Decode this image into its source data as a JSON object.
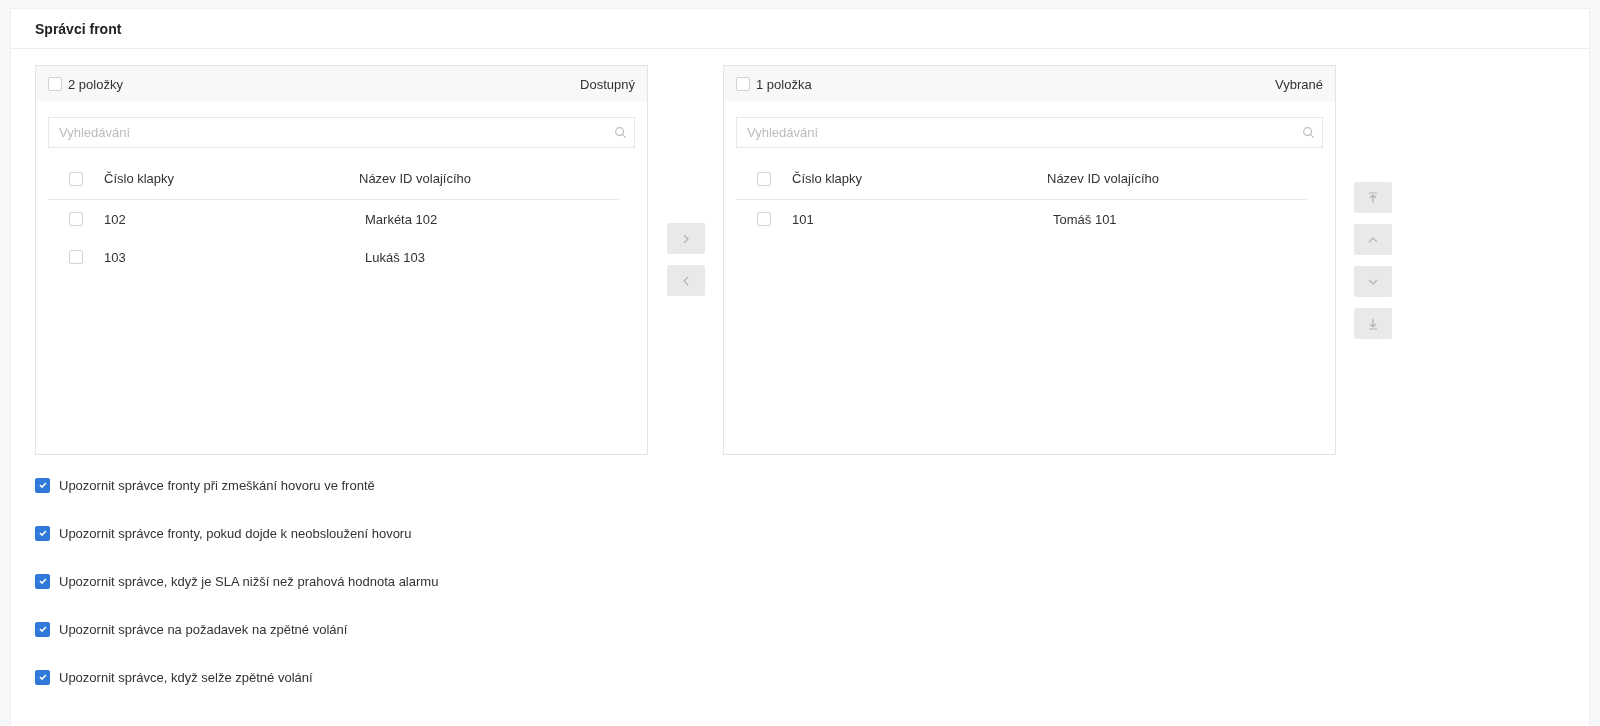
{
  "section": {
    "title": "Správci front"
  },
  "panels": [
    {
      "count": "2 položky",
      "title": "Dostupný",
      "all_checked": false,
      "search": {
        "placeholder": "Vyhledávání"
      },
      "columns": [
        "Číslo klapky",
        "Název ID volajícího"
      ],
      "header_checked": false,
      "rows": [
        {
          "cells": [
            "102",
            "Markéta 102"
          ],
          "checked": false
        },
        {
          "cells": [
            "103",
            "Lukáš 103"
          ],
          "checked": false
        }
      ]
    },
    {
      "count": "1 položka",
      "title": "Vybrané",
      "all_checked": false,
      "search": {
        "placeholder": "Vyhledávání"
      },
      "columns": [
        "Číslo klapky",
        "Název ID volajícího"
      ],
      "header_checked": false,
      "rows": [
        {
          "cells": [
            "101",
            "Tomáš 101"
          ],
          "checked": false
        }
      ]
    }
  ],
  "transfer_buttons": [
    {
      "kind": "right",
      "disabled": true
    },
    {
      "kind": "left",
      "disabled": true
    }
  ],
  "order_buttons": [
    {
      "kind": "top",
      "disabled": true
    },
    {
      "kind": "up",
      "disabled": true
    },
    {
      "kind": "down",
      "disabled": true
    },
    {
      "kind": "bottom",
      "disabled": true
    }
  ],
  "options": [
    {
      "label": "Upozornit správce fronty při zmeškání hovoru ve frontě",
      "checked": true
    },
    {
      "label": "Upozornit správce fronty, pokud dojde k neobsloužení hovoru",
      "checked": true
    },
    {
      "label": "Upozornit správce, když je SLA nižší než prahová hodnota alarmu",
      "checked": true
    },
    {
      "label": "Upozornit správce na požadavek na zpětné volání",
      "checked": true
    },
    {
      "label": "Upozornit správce, když selže zpětné volání",
      "checked": true
    }
  ]
}
